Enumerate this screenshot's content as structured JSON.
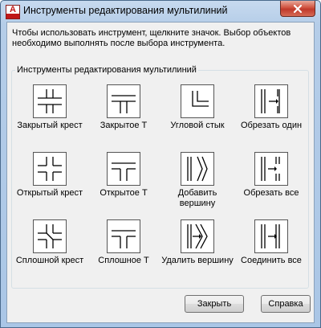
{
  "window": {
    "title": "Инструменты редактирования мультилиний",
    "app_icon_letter": "A",
    "close_icon": "close-icon"
  },
  "instructions": "Чтобы использовать инструмент, щелкните значок. Выбор объектов необходимо выполнять после выбора инструмента.",
  "group": {
    "title": "Инструменты редактирования мультилиний",
    "tools": [
      {
        "label": "Закрытый крест",
        "icon": "closed-cross-icon"
      },
      {
        "label": "Закрытое Т",
        "icon": "closed-tee-icon"
      },
      {
        "label": "Угловой стык",
        "icon": "corner-joint-icon"
      },
      {
        "label": "Обрезать один",
        "icon": "cut-single-icon"
      },
      {
        "label": "Открытый крест",
        "icon": "open-cross-icon"
      },
      {
        "label": "Открытое Т",
        "icon": "open-tee-icon"
      },
      {
        "label": "Добавить вершину",
        "icon": "add-vertex-icon"
      },
      {
        "label": "Обрезать все",
        "icon": "cut-all-icon"
      },
      {
        "label": "Сплошной крест",
        "icon": "merged-cross-icon"
      },
      {
        "label": "Сплошное Т",
        "icon": "merged-tee-icon"
      },
      {
        "label": "Удалить вершину",
        "icon": "delete-vertex-icon"
      },
      {
        "label": "Соединить все",
        "icon": "weld-all-icon"
      }
    ]
  },
  "buttons": {
    "close_label": "Закрыть",
    "help_label": "Справка"
  },
  "colors": {
    "title_bar": "#b5cde8",
    "close_button": "#c0392b",
    "dialog_background": "#f0f0f0"
  }
}
